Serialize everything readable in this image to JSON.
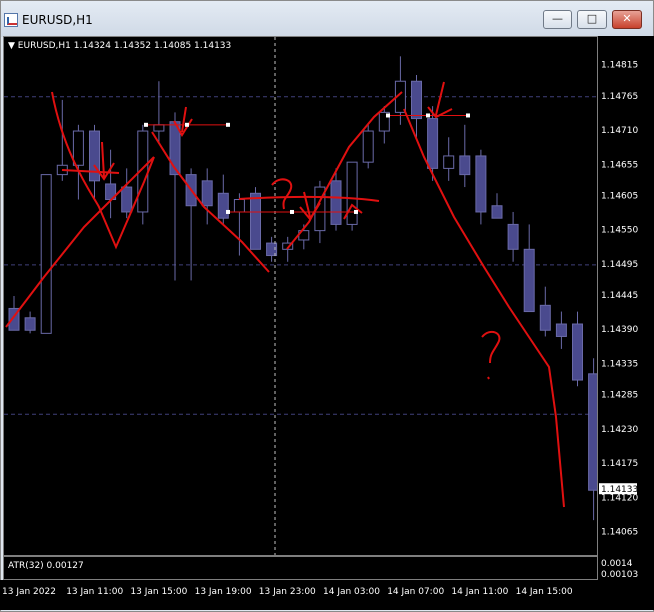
{
  "window": {
    "title": "EURUSD,H1",
    "minimize_label": "—",
    "maximize_label": "□",
    "close_label": "✕",
    "icon": "chart-app-icon"
  },
  "chart": {
    "header_symbol": "EURUSD,H1",
    "header_ohlc": "1.14324 1.14352 1.14085 1.14133",
    "current_price": "1.14133",
    "colors": {
      "bull": "#000000",
      "bear": "#4a4a8e",
      "wick": "#6a6aa8",
      "grid": "#40407a",
      "annotation": "#e01010"
    }
  },
  "chart_data": {
    "type": "candlestick",
    "title": "EURUSD,H1",
    "y_ticks": [
      "1.14815",
      "1.14765",
      "1.14710",
      "1.14655",
      "1.14605",
      "1.14550",
      "1.14495",
      "1.14445",
      "1.14390",
      "1.14335",
      "1.14285",
      "1.14230",
      "1.14175",
      "1.14120",
      "1.14065"
    ],
    "x_ticks": [
      "13 Jan 2022",
      "13 Jan 11:00",
      "13 Jan 15:00",
      "13 Jan 19:00",
      "13 Jan 23:00",
      "14 Jan 03:00",
      "14 Jan 07:00",
      "14 Jan 11:00",
      "14 Jan 15:00"
    ],
    "ylim": [
      1.14045,
      1.14845
    ],
    "candles": [
      {
        "o": 1.14425,
        "h": 1.14445,
        "l": 1.1439,
        "c": 1.1439
      },
      {
        "o": 1.1441,
        "h": 1.1442,
        "l": 1.14385,
        "c": 1.1439
      },
      {
        "o": 1.14385,
        "h": 1.1464,
        "l": 1.14385,
        "c": 1.1464
      },
      {
        "o": 1.1464,
        "h": 1.1476,
        "l": 1.1463,
        "c": 1.14655
      },
      {
        "o": 1.14655,
        "h": 1.1472,
        "l": 1.146,
        "c": 1.1471
      },
      {
        "o": 1.1471,
        "h": 1.1472,
        "l": 1.146,
        "c": 1.1463
      },
      {
        "o": 1.14625,
        "h": 1.1468,
        "l": 1.1457,
        "c": 1.146
      },
      {
        "o": 1.1462,
        "h": 1.1465,
        "l": 1.1457,
        "c": 1.1458
      },
      {
        "o": 1.1458,
        "h": 1.1472,
        "l": 1.1456,
        "c": 1.1471
      },
      {
        "o": 1.1471,
        "h": 1.1479,
        "l": 1.1469,
        "c": 1.1472
      },
      {
        "o": 1.14725,
        "h": 1.1474,
        "l": 1.1447,
        "c": 1.1464
      },
      {
        "o": 1.1464,
        "h": 1.1465,
        "l": 1.1447,
        "c": 1.1459
      },
      {
        "o": 1.1463,
        "h": 1.1465,
        "l": 1.1456,
        "c": 1.1459
      },
      {
        "o": 1.1461,
        "h": 1.1464,
        "l": 1.1456,
        "c": 1.1457
      },
      {
        "o": 1.1458,
        "h": 1.1461,
        "l": 1.1451,
        "c": 1.146
      },
      {
        "o": 1.1461,
        "h": 1.1462,
        "l": 1.1452,
        "c": 1.1452
      },
      {
        "o": 1.1453,
        "h": 1.1454,
        "l": 1.145,
        "c": 1.1451
      },
      {
        "o": 1.1452,
        "h": 1.1454,
        "l": 1.145,
        "c": 1.1453
      },
      {
        "o": 1.14535,
        "h": 1.1456,
        "l": 1.1452,
        "c": 1.1455
      },
      {
        "o": 1.1455,
        "h": 1.1463,
        "l": 1.1453,
        "c": 1.1462
      },
      {
        "o": 1.1463,
        "h": 1.1465,
        "l": 1.1455,
        "c": 1.1456
      },
      {
        "o": 1.1456,
        "h": 1.1466,
        "l": 1.1455,
        "c": 1.1466
      },
      {
        "o": 1.1466,
        "h": 1.1472,
        "l": 1.1465,
        "c": 1.1471
      },
      {
        "o": 1.1471,
        "h": 1.1475,
        "l": 1.1469,
        "c": 1.1474
      },
      {
        "o": 1.1474,
        "h": 1.1483,
        "l": 1.1472,
        "c": 1.1479
      },
      {
        "o": 1.1479,
        "h": 1.148,
        "l": 1.147,
        "c": 1.1473
      },
      {
        "o": 1.1473,
        "h": 1.1475,
        "l": 1.1463,
        "c": 1.1465
      },
      {
        "o": 1.1465,
        "h": 1.147,
        "l": 1.1463,
        "c": 1.1467
      },
      {
        "o": 1.1467,
        "h": 1.1472,
        "l": 1.1462,
        "c": 1.1464
      },
      {
        "o": 1.1467,
        "h": 1.1468,
        "l": 1.1456,
        "c": 1.1458
      },
      {
        "o": 1.1459,
        "h": 1.1461,
        "l": 1.1457,
        "c": 1.1457
      },
      {
        "o": 1.1456,
        "h": 1.1458,
        "l": 1.145,
        "c": 1.1452
      },
      {
        "o": 1.1452,
        "h": 1.1456,
        "l": 1.1442,
        "c": 1.1442
      },
      {
        "o": 1.1443,
        "h": 1.1446,
        "l": 1.1438,
        "c": 1.1439
      },
      {
        "o": 1.144,
        "h": 1.1442,
        "l": 1.1436,
        "c": 1.1438
      },
      {
        "o": 1.144,
        "h": 1.1442,
        "l": 1.143,
        "c": 1.1431
      },
      {
        "o": 1.1432,
        "h": 1.14345,
        "l": 1.14085,
        "c": 1.14133
      }
    ],
    "h_levels": [
      1.14765,
      1.14495,
      1.14255
    ],
    "v_marker_x": "13 Jan 23:00"
  },
  "atr": {
    "label": "ATR(32) 0.00127",
    "axis_top": "0.0014",
    "axis_bottom": "0.00103"
  }
}
